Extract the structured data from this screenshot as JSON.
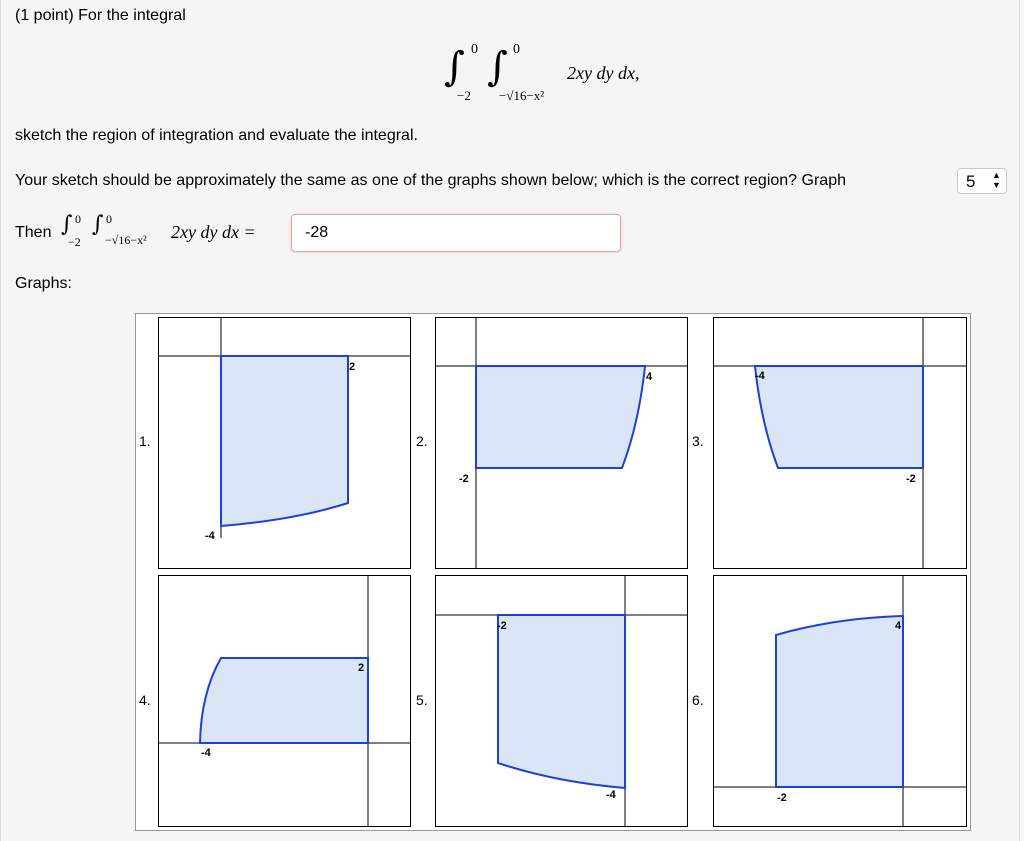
{
  "problem": {
    "intro": "(1 point) For the integral",
    "integral": {
      "outer_lower": "−2",
      "outer_upper": "0",
      "inner_lower": "−√16−x²",
      "inner_upper": "0",
      "integrand": "2xy dy dx,"
    },
    "instruction": "sketch the region of integration and evaluate the integral.",
    "question": "Your sketch should be approximately the same as one of the graphs shown below; which is the correct region? Graph",
    "then_label": "Then",
    "then_expr": {
      "outer_lower": "−2",
      "outer_upper": "0",
      "inner_lower": "−√16−x²",
      "inner_upper": "0",
      "integrand": "2xy dy dx ="
    },
    "graphs_label": "Graphs:"
  },
  "graph_select": {
    "value": "5"
  },
  "answer_input": {
    "value": "-28"
  },
  "colors": {
    "region_fill": "#dae6f6",
    "region_edge": "#1e3fe0",
    "axis": "#000000"
  },
  "graphs": [
    {
      "label": "1.",
      "ticks": [
        "2",
        "-4"
      ]
    },
    {
      "label": "2.",
      "ticks": [
        "4",
        "-2"
      ]
    },
    {
      "label": "3.",
      "ticks": [
        "-4",
        "-2"
      ]
    },
    {
      "label": "4.",
      "ticks": [
        "2",
        "-4"
      ]
    },
    {
      "label": "5.",
      "ticks": [
        "-2",
        "-4"
      ]
    },
    {
      "label": "6.",
      "ticks": [
        "4",
        "-2"
      ]
    }
  ]
}
